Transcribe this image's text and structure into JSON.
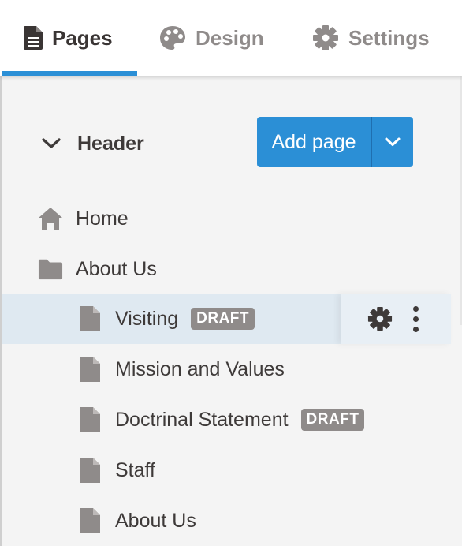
{
  "tabs": [
    {
      "label": "Pages",
      "icon": "document-icon",
      "active": true
    },
    {
      "label": "Design",
      "icon": "palette-icon",
      "active": false
    },
    {
      "label": "Settings",
      "icon": "gear-icon",
      "active": false
    }
  ],
  "section": {
    "label": "Header",
    "expanded": true
  },
  "add_button": {
    "label": "Add page"
  },
  "tree": [
    {
      "label": "Home",
      "icon": "home-icon",
      "level": 0
    },
    {
      "label": "About Us",
      "icon": "folder-icon",
      "level": 0
    },
    {
      "label": "Visiting",
      "icon": "page-icon",
      "level": 1,
      "badge": "DRAFT",
      "selected": true
    },
    {
      "label": "Mission and Values",
      "icon": "page-icon",
      "level": 1
    },
    {
      "label": "Doctrinal Statement",
      "icon": "page-icon",
      "level": 1,
      "badge": "DRAFT"
    },
    {
      "label": "Staff",
      "icon": "page-icon",
      "level": 1
    },
    {
      "label": "About Us",
      "icon": "page-icon",
      "level": 1
    }
  ],
  "colors": {
    "accent": "#2b8fd6",
    "badge": "#8f8b8a",
    "selected_row": "#dfe9f1"
  }
}
